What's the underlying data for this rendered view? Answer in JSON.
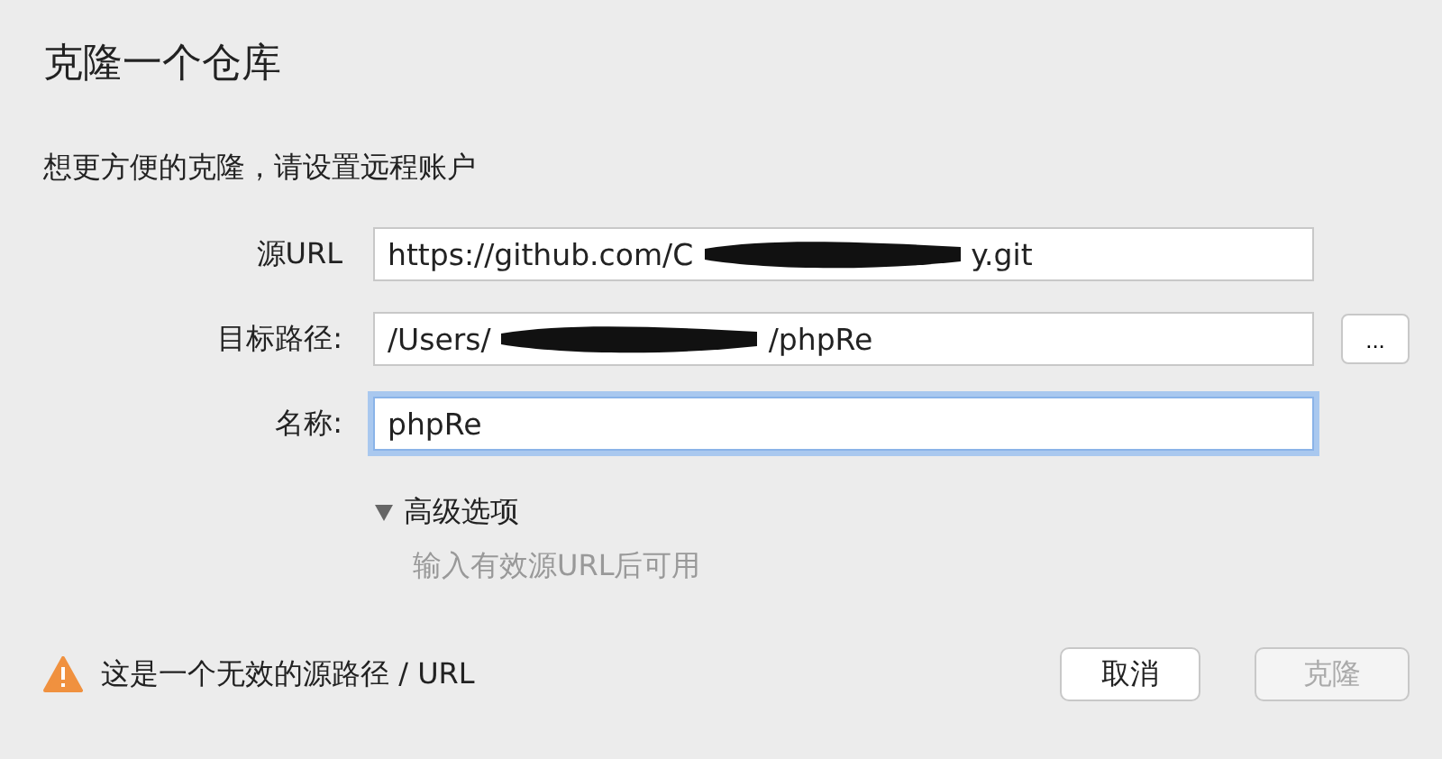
{
  "title": "克隆一个仓库",
  "subtitle": "想更方便的克隆，请设置远程账户",
  "fields": [
    {
      "label": "源URL",
      "value_start": "https://github.com/C",
      "value_end": "y.git",
      "redacted": true,
      "focused": false
    },
    {
      "label": "目标路径:",
      "value_start": "/Users/",
      "value_end": "/phpRe",
      "redacted": true,
      "focused": false,
      "browse": "..."
    },
    {
      "label": "名称:",
      "value_start": "phpRe",
      "redacted": false,
      "focused": true
    }
  ],
  "advanced": {
    "label": "高级选项",
    "expanded": true,
    "hint": "输入有效源URL后可用"
  },
  "warning": {
    "text": "这是一个无效的源路径 / URL"
  },
  "buttons": [
    {
      "label": "取消",
      "disabled": false
    },
    {
      "label": "克隆",
      "disabled": true
    }
  ]
}
